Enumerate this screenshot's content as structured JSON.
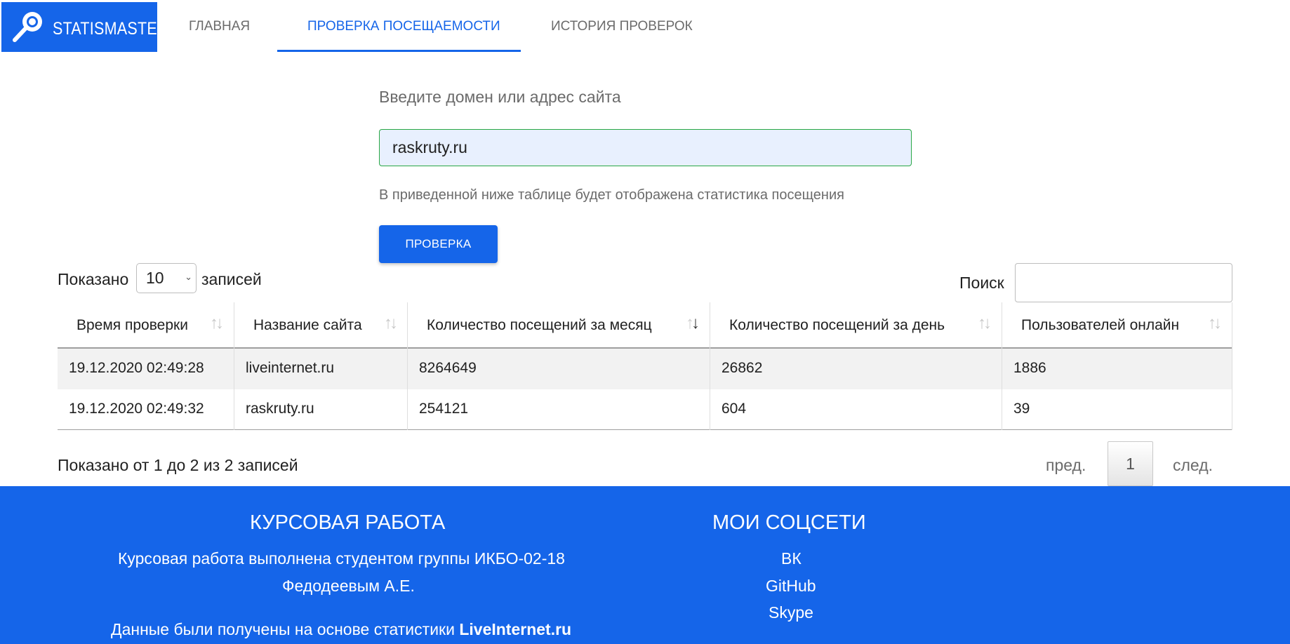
{
  "brand": {
    "name": "STATISMASTER",
    "logo_icon": "magnifier-icon"
  },
  "nav": {
    "items": [
      {
        "label": "ГЛАВНАЯ",
        "active": false
      },
      {
        "label": "ПРОВЕРКА ПОСЕЩАЕМОСТИ",
        "active": true
      },
      {
        "label": "ИСТОРИЯ ПРОВЕРОК",
        "active": false
      }
    ]
  },
  "form": {
    "label": "Введите домен или адрес сайта",
    "domain_value": "raskruty.ru",
    "help_text": "В приведенной ниже таблице будет отображена статистика посещения",
    "button_label": "ПРОВЕРКА"
  },
  "table_controls": {
    "length_prefix": "Показано",
    "length_value": "10",
    "length_suffix": "записей",
    "search_label": "Поиск",
    "search_value": ""
  },
  "table": {
    "columns": [
      "Время проверки",
      "Название сайта",
      "Количество посещений за месяц",
      "Количество посещений за день",
      "Пользователей онлайн"
    ],
    "sorted_column_index": 2,
    "rows": [
      [
        "19.12.2020 02:49:28",
        "liveinternet.ru",
        "8264649",
        "26862",
        "1886"
      ],
      [
        "19.12.2020 02:49:32",
        "raskruty.ru",
        "254121",
        "604",
        "39"
      ]
    ]
  },
  "info": "Показано от 1 до 2 из 2 записей",
  "pagination": {
    "prev": "пред.",
    "page": "1",
    "next": "след."
  },
  "footer": {
    "left": {
      "title": "КУРСОВАЯ РАБОТА",
      "line1": "Курсовая работа выполнена студентом группы ИКБО-02-18",
      "line2": "Федодеевым А.Е.",
      "source_prefix": "Данные были получены на основе статистики",
      "source_bold": "LiveInternet.ru"
    },
    "right": {
      "title": "МОИ СОЦСЕТИ",
      "links": [
        "ВК",
        "GitHub",
        "Skype"
      ]
    }
  },
  "colors": {
    "accent": "#1565e9",
    "input_valid_border": "#28a745",
    "input_fill": "#e8f0fe"
  }
}
